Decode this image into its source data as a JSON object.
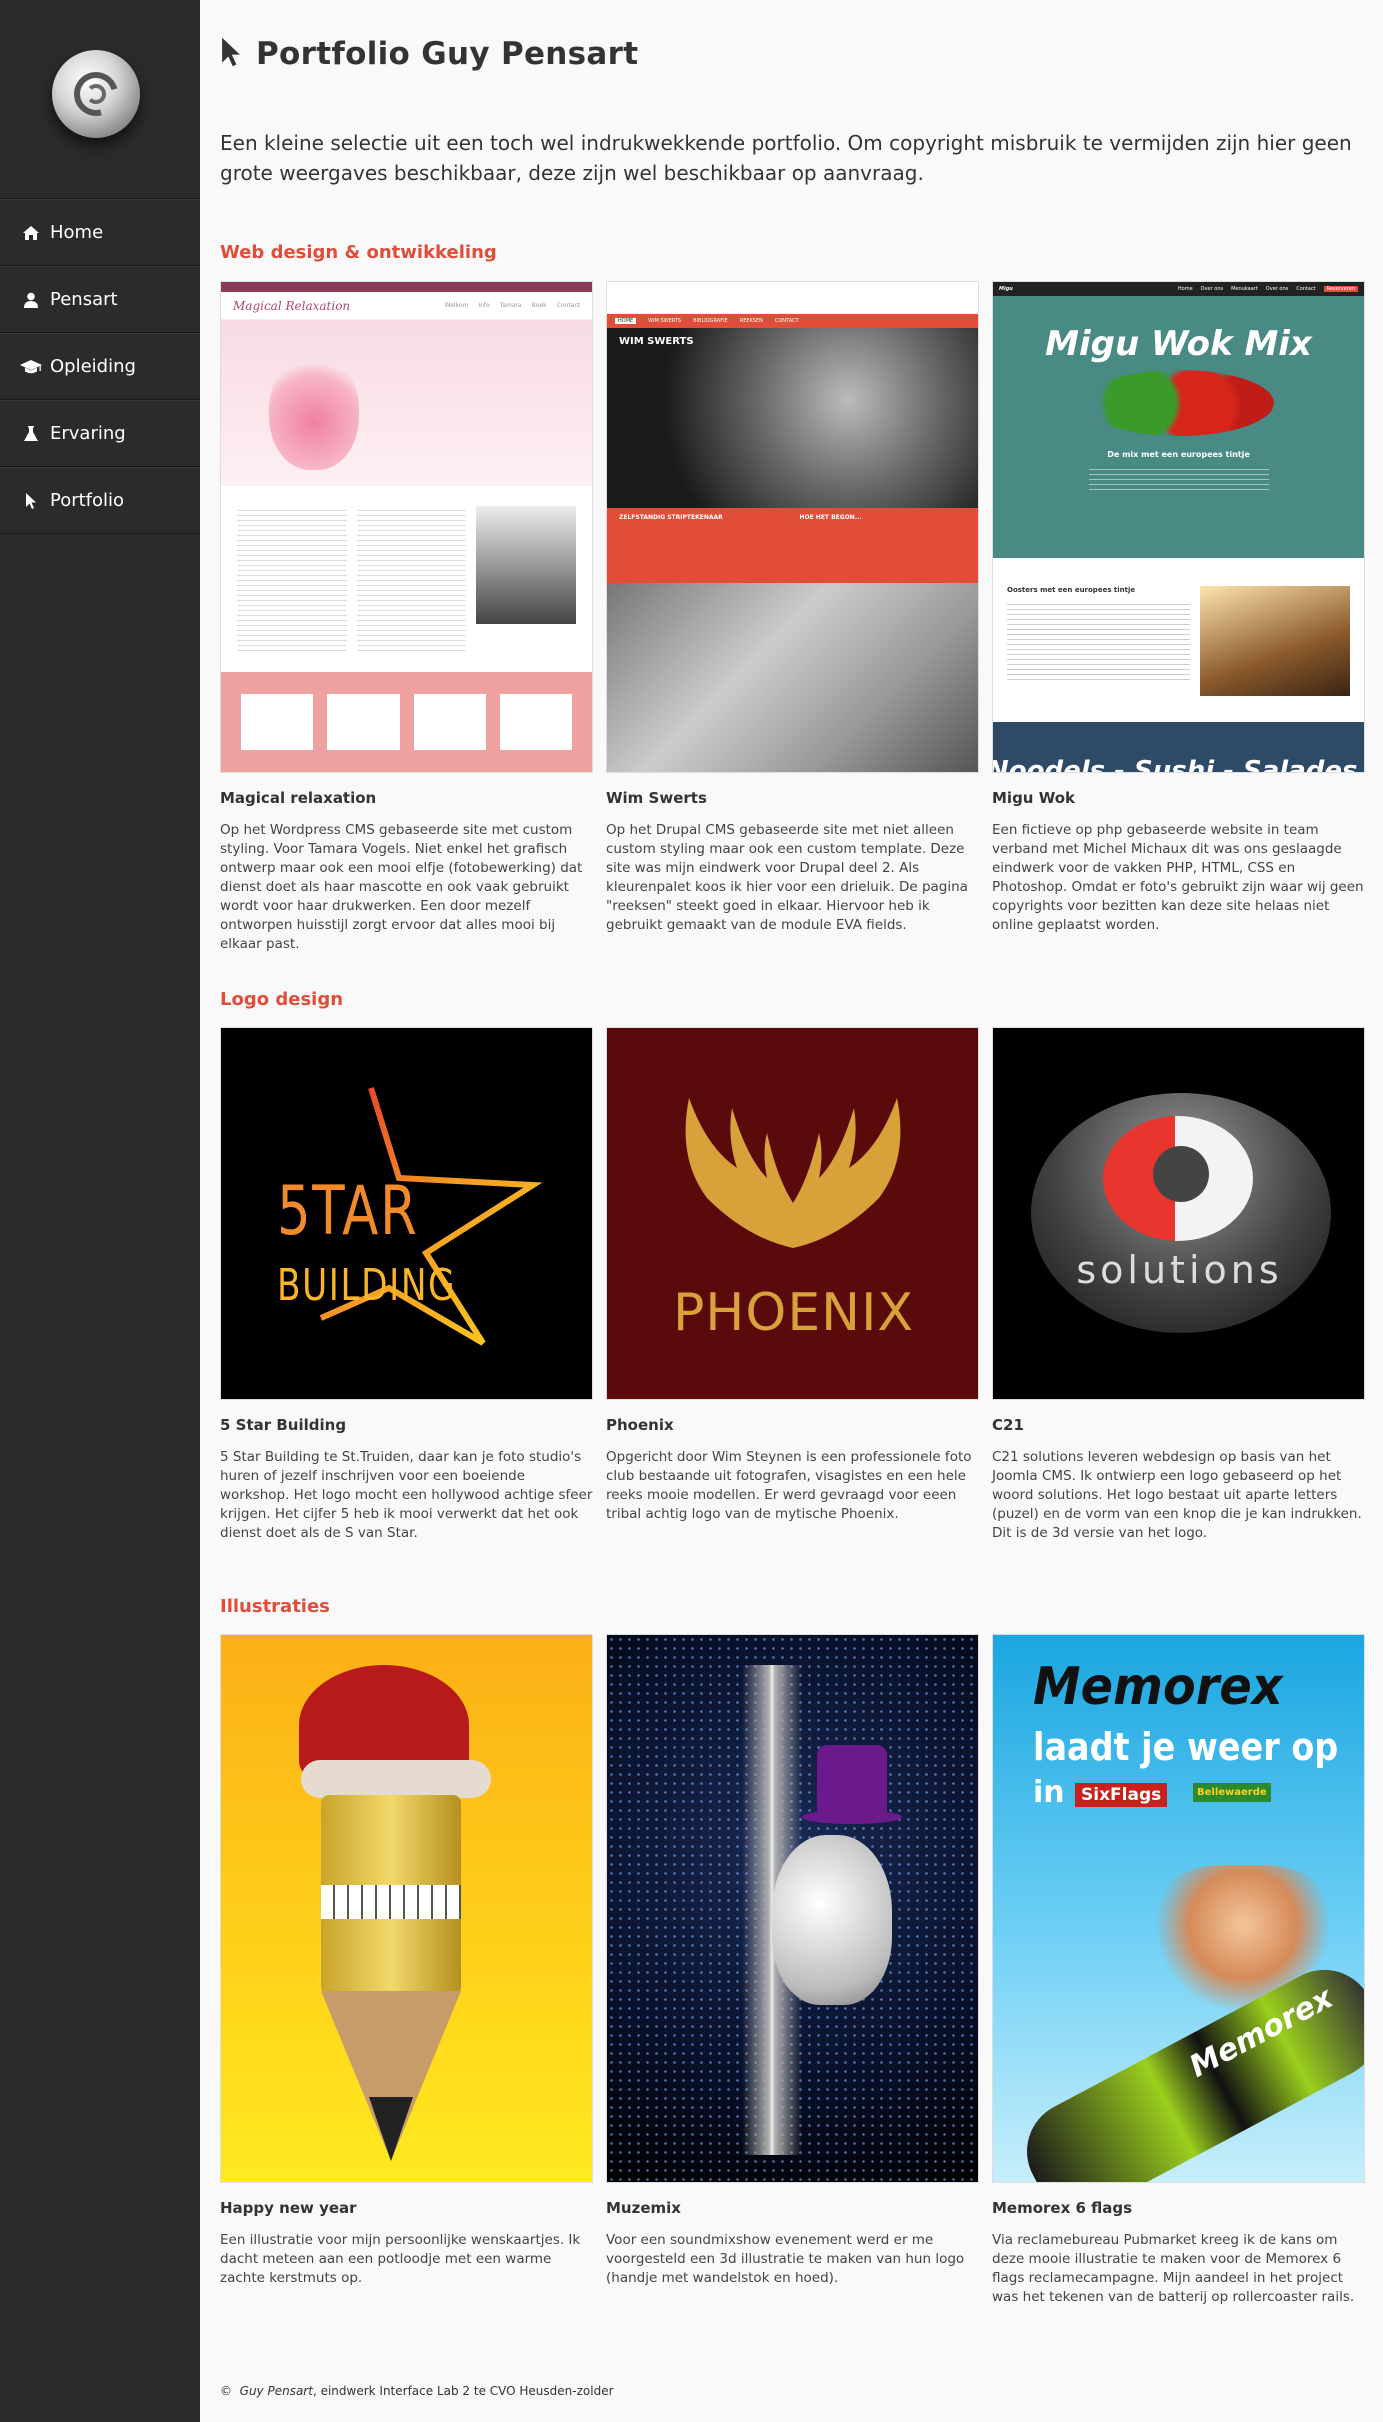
{
  "sidebar": {
    "items": [
      {
        "label": "Home",
        "icon": "home-icon"
      },
      {
        "label": "Pensart",
        "icon": "user-icon"
      },
      {
        "label": "Opleiding",
        "icon": "graduation-cap-icon"
      },
      {
        "label": "Ervaring",
        "icon": "flask-icon"
      },
      {
        "label": "Portfolio",
        "icon": "cursor-icon"
      }
    ]
  },
  "page": {
    "title": "Portfolio Guy Pensart",
    "intro": "Een kleine selectie uit een toch wel indrukwekkende portfolio. Om copyright misbruik te vermijden zijn hier geen grote weergaves beschikbaar, deze zijn wel beschikbaar op aanvraag."
  },
  "sections": [
    {
      "title": "Web design & ontwikkeling",
      "cards": [
        {
          "title": "Magical relaxation",
          "desc": "Op het Wordpress CMS gebaseerde site met custom styling. Voor Tamara Vogels. Niet enkel het grafisch ontwerp maar ook een mooi elfje (fotobewerking) dat dienst doet als haar mascotte en ook vaak gebruikt wordt voor haar drukwerken. Een door mezelf ontworpen huisstijl zorgt ervoor dat alles mooi bij elkaar past.",
          "thumb": {
            "site_title": "Magical Relaxation",
            "menu": [
              "Welkom",
              "Info",
              "Tamara",
              "Boek",
              "Contact"
            ]
          }
        },
        {
          "title": "Wim Swerts",
          "desc": "Op het Drupal CMS gebaseerde site met niet alleen custom styling maar ook een custom template. Deze site was mijn eindwerk voor Drupal deel 2. Als kleurenpalet koos ik hier voor een drieluik. De pagina \"reeksen\" steekt goed in elkaar. Hiervoor heb ik gebruikt gemaakt van de module EVA fields.",
          "thumb": {
            "menu": [
              "HOME",
              "WIM SWERTS",
              "BIBLIOGRAFIE",
              "REEKSEN",
              "CONTACT"
            ],
            "banner": "WIM SWERTS",
            "col1": "ZELFSTANDIG STRIPTEKENAAR",
            "col2": "HOE HET BEGON..."
          }
        },
        {
          "title": "Migu Wok",
          "desc": "Een fictieve op php gebaseerde website in team verband met Michel Michaux dit was ons geslaagde eindwerk voor de vakken PHP, HTML, CSS en Photoshop. Omdat er foto's gebruikt zijn waar wij geen copyrights voor bezitten kan deze site helaas niet online geplaatst worden.",
          "thumb": {
            "brand": "Migu",
            "menu": [
              "Home",
              "Over ons",
              "Menukaart",
              "Over ons",
              "Contact",
              "Reserveren"
            ],
            "hero": "Migu Wok Mix",
            "tagline": "De mix met een europees tintje",
            "sub": "Oosters met een europees tintje",
            "footer_text": "Noodels - Sushi - Salades"
          }
        }
      ]
    },
    {
      "title": "Logo design",
      "cards": [
        {
          "title": "5 Star Building",
          "desc": "5 Star Building te St.Truiden, daar kan je foto studio's huren of jezelf inschrijven voor een boeiende workshop. Het logo mocht een hollywood achtige sfeer krijgen. Het cijfer 5 heb ik mooi verwerkt dat het ook dienst doet als de S van Star.",
          "logo": {
            "line1": "5TAR",
            "line2": "BUILDING"
          }
        },
        {
          "title": "Phoenix",
          "desc": "Opgericht door Wim Steynen is een professionele foto club bestaande uit fotografen, visagistes en een hele reeks mooie modellen. Er werd gevraagd voor eeen tribal achtig logo van de mytische Phoenix.",
          "logo": {
            "word": "PHOENIX"
          }
        },
        {
          "title": "C21",
          "desc": "C21 solutions leveren webdesign op basis van het Joomla CMS. Ik ontwierp een logo gebaseerd op het woord solutions. Het logo bestaat uit aparte letters (puzel) en de vorm van een knop die je kan indrukken. Dit is de 3d versie van het logo.",
          "logo": {
            "word": "solutions"
          }
        }
      ]
    },
    {
      "title": "Illustraties",
      "cards": [
        {
          "title": "Happy new year",
          "desc": "Een illustratie voor mijn persoonlijke wenskaartjes. Ik dacht meteen aan een potloodje met een warme zachte kerstmuts op."
        },
        {
          "title": "Muzemix",
          "desc": "Voor een soundmixshow evenement werd er me voorgesteld een 3d illustratie te maken van hun logo (handje met wandelstok en hoed)."
        },
        {
          "title": "Memorex 6 flags",
          "desc": "Via reclamebureau Pubmarket kreeg ik de kans om deze mooie illustratie te maken voor de Memorex 6 flags reclamecampagne. Mijn aandeel in het project was het tekenen van de batterij op rollercoaster rails.",
          "poster": {
            "brand": "Memorex",
            "headline": "laadt je weer op",
            "in": "in",
            "sponsor1": "SixFlags",
            "sponsor2": "Bellewaerde",
            "battery": "Memorex"
          }
        }
      ]
    }
  ],
  "footer": {
    "symbol": "©",
    "author": "Guy Pensart",
    "text": ", eindwerk Interface Lab 2 te CVO Heusden-zolder"
  },
  "colors": {
    "accent": "#e04e39",
    "sidebar": "#2b2b2b",
    "background": "#f9f9f9"
  }
}
